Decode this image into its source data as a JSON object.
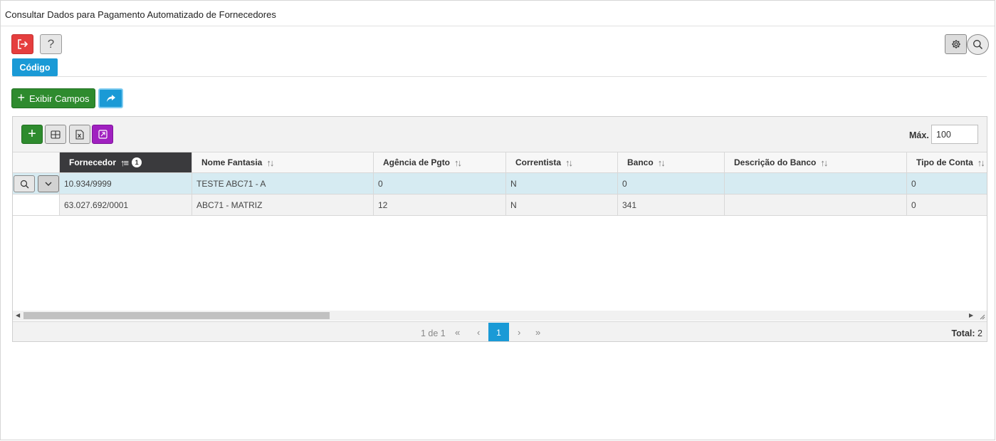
{
  "window": {
    "title": "Consultar Dados para Pagamento Automatizado de Fornecedores"
  },
  "top_actions": {
    "exit_icon": "exit-icon",
    "help_label": "?",
    "settings_icon": "gear-icon",
    "search_icon": "search-icon"
  },
  "tabs": [
    {
      "label": "Código",
      "active": true
    }
  ],
  "actions": {
    "show_fields_label": "Exibir Campos",
    "share_icon": "share-icon"
  },
  "grid": {
    "toolbar": {
      "max_label": "Máx.",
      "max_value": "100"
    },
    "columns": [
      {
        "label": "Fornecedor",
        "sorted": true,
        "sort_order": "1"
      },
      {
        "label": "Nome Fantasia"
      },
      {
        "label": "Agência de Pgto"
      },
      {
        "label": "Correntista"
      },
      {
        "label": "Banco"
      },
      {
        "label": "Descrição do Banco"
      },
      {
        "label": "Tipo de Conta"
      }
    ],
    "rows": [
      {
        "fornecedor": "10.934/9999",
        "nome_fantasia": "TESTE ABC71 - A",
        "agencia": "0",
        "correntista": "N",
        "banco": "0",
        "descricao_banco": "",
        "tipo_conta": "0",
        "selected": true
      },
      {
        "fornecedor": "63.027.692/0001",
        "nome_fantasia": "ABC71 - MATRIZ",
        "agencia": "12",
        "correntista": "N",
        "banco": "341",
        "descricao_banco": "",
        "tipo_conta": "0",
        "selected": false
      }
    ],
    "pager": {
      "page_info": "1 de 1",
      "first": "«",
      "prev": "‹",
      "current": "1",
      "next": "›",
      "last": "»",
      "total_label": "Total:",
      "total_value": "2"
    }
  },
  "colors": {
    "accent": "#1a9ad6",
    "success": "#2e8b2e",
    "danger": "#e53e3e",
    "purple": "#a020c0",
    "selected_row": "#d6ebf2"
  }
}
